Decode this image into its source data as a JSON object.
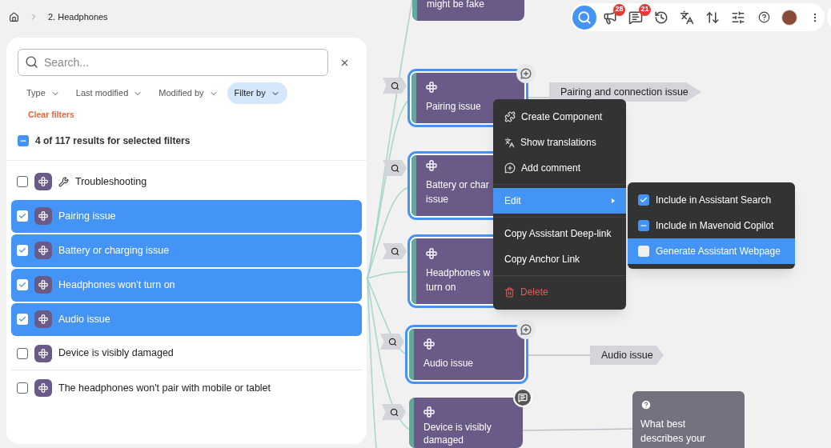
{
  "breadcrumb": {
    "items": [
      "2. Headphones"
    ]
  },
  "toolbar": {
    "buttons": [
      {
        "kind": "search",
        "selected": true
      },
      {
        "kind": "announcements",
        "selected": false,
        "badge": "28"
      },
      {
        "kind": "comments",
        "selected": false,
        "badge": "21"
      },
      {
        "kind": "history",
        "selected": false
      },
      {
        "kind": "translate",
        "selected": false
      },
      {
        "kind": "sort",
        "selected": false
      },
      {
        "kind": "settings",
        "selected": false
      },
      {
        "kind": "help",
        "selected": false
      },
      {
        "kind": "avatar",
        "selected": false
      },
      {
        "kind": "more",
        "selected": false
      }
    ]
  },
  "panel": {
    "search": {
      "placeholder": "Search..."
    },
    "filters": [
      {
        "label": "Type",
        "selected": false
      },
      {
        "label": "Last modified",
        "selected": false
      },
      {
        "label": "Modified by",
        "selected": false
      },
      {
        "label": "Filter by",
        "selected": true
      }
    ],
    "clear_filters": "Clear filters",
    "summary": {
      "label": "4 of 117 results for selected filters",
      "checked": true,
      "indeterminate": true
    },
    "results": [
      {
        "label": "Troubleshooting",
        "kind": "folder",
        "checked": false,
        "selected": false
      },
      {
        "label": "Pairing issue",
        "kind": "node",
        "checked": true,
        "selected": true
      },
      {
        "label": "Battery or charging issue",
        "kind": "node",
        "checked": true,
        "selected": true
      },
      {
        "label": "Headphones won't turn on",
        "kind": "node",
        "checked": true,
        "selected": true
      },
      {
        "label": "Audio issue",
        "kind": "node",
        "checked": true,
        "selected": true
      },
      {
        "label": "Device is visibly damaged",
        "kind": "node",
        "checked": false,
        "selected": false
      },
      {
        "label": "The headphones won't pair with mobile or tablet",
        "kind": "node",
        "checked": false,
        "selected": false
      }
    ]
  },
  "canvas": {
    "nodes": [
      {
        "lines": [
          "might be fake"
        ],
        "selected": false
      },
      {
        "lines": [
          "Pairing issue"
        ],
        "selected": true,
        "add_comment": true,
        "has_comments": false
      },
      {
        "lines": [
          "Battery or char",
          "issue"
        ],
        "selected": true,
        "add_comment": false,
        "has_comments": false
      },
      {
        "lines": [
          "Headphones w",
          "turn on"
        ],
        "selected": true,
        "add_comment": false,
        "has_comments": false
      },
      {
        "lines": [
          "Audio issue"
        ],
        "selected": true,
        "add_comment": true,
        "has_comments": false
      },
      {
        "lines": [
          "Device is visibly",
          "damaged"
        ],
        "selected": false,
        "add_comment": false,
        "has_comments": true
      }
    ],
    "tags": [
      "Pairing and connection issue",
      "Audio issue"
    ],
    "question": {
      "text": "What best describes your"
    }
  },
  "context_menu": {
    "items": [
      {
        "kind": "component",
        "label": "Create Component",
        "highlighted": false
      },
      {
        "kind": "translate",
        "label": "Show translations",
        "highlighted": false
      },
      {
        "kind": "comment",
        "label": "Add comment",
        "highlighted": false
      },
      {
        "kind": "divider"
      },
      {
        "kind": "submenu",
        "label": "Edit",
        "highlighted": true
      },
      {
        "kind": "divider"
      },
      {
        "kind": "link",
        "label": "Copy Assistant Deep-link",
        "highlighted": false
      },
      {
        "kind": "link",
        "label": "Copy Anchor Link",
        "highlighted": false
      },
      {
        "kind": "divider"
      },
      {
        "kind": "delete",
        "label": "Delete",
        "highlighted": false
      }
    ],
    "submenu": [
      {
        "label": "Include in Assistant Search",
        "checked": true,
        "highlighted": false
      },
      {
        "label": "Include in Mavenoid Copilot",
        "checked": true,
        "indeterminate": true,
        "highlighted": false
      },
      {
        "label": "Generate Assistant Webpage",
        "checked": false,
        "highlighted": true
      }
    ]
  }
}
